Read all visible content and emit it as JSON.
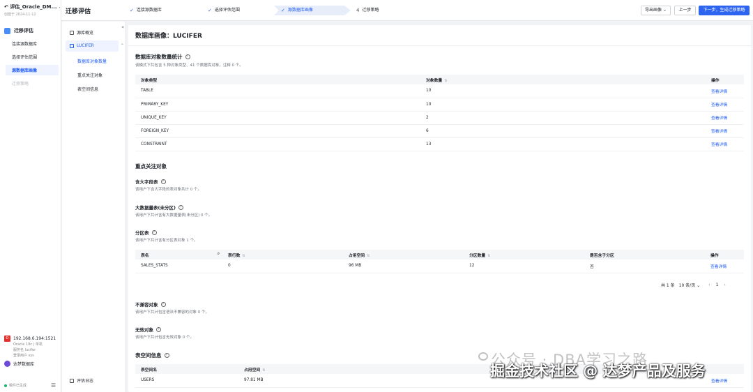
{
  "project": {
    "title": "评估_Oracle_DM...",
    "created": "创建于 2024-11-12"
  },
  "left_nav": {
    "section": "迁移评估",
    "items": [
      {
        "label": "连接源数据库",
        "state": "normal"
      },
      {
        "label": "选择评估范围",
        "state": "normal"
      },
      {
        "label": "源数据库画像",
        "state": "active"
      },
      {
        "label": "迁移策略",
        "state": "disabled"
      }
    ]
  },
  "source": {
    "ip": "192.168.6.194:1521",
    "desc1": "Oracle 19c | 单机",
    "desc2": "服务名 lucifer",
    "desc3": "登录用户 sys",
    "target": "达梦数据库"
  },
  "saved": "稿件已生成",
  "header": {
    "title": "迁移评估",
    "steps": [
      {
        "label": "连接源数据库",
        "state": "done"
      },
      {
        "label": "选择评估范围",
        "state": "done"
      },
      {
        "label": "源数据库画像",
        "state": "current"
      },
      {
        "label": "迁移策略",
        "num": "4",
        "state": "todo"
      }
    ],
    "export": "导出画像",
    "prev": "上一步",
    "next": "下一步，生成迁移策略"
  },
  "subnav": {
    "overview": "源库概览",
    "db": "LUCIFER",
    "subs": [
      "数据库对象数量",
      "重点关注对象",
      "表空间信息"
    ],
    "log": "评估日志"
  },
  "main": {
    "title": "数据库画像：LUCIFER",
    "obj_stats": {
      "title": "数据库对象数量统计",
      "desc": "该模式下共包含 5 种对象类型、41 个数据库对象，注释 0 个。",
      "columns": [
        "对象类型",
        "对象数量",
        "操作"
      ],
      "rows": [
        {
          "type": "TABLE",
          "count": "10",
          "action": "查看详情"
        },
        {
          "type": "PRIMARY_KEY",
          "count": "10",
          "action": "查看详情"
        },
        {
          "type": "UNIQUE_KEY",
          "count": "2",
          "action": "查看详情"
        },
        {
          "type": "FOREIGN_KEY",
          "count": "6",
          "action": "查看详情"
        },
        {
          "type": "CONSTRAINT",
          "count": "13",
          "action": "查看详情"
        }
      ]
    },
    "focus": {
      "title": "重点关注对象",
      "big_field": {
        "title": "含大字段表",
        "desc": "该用户下含大字段的表对象共计 0 个。"
      },
      "big_table": {
        "title": "大数据量表(未分区)",
        "desc": "该用户下共计含有大数据量表(未分区) 0 个。"
      },
      "partition": {
        "title": "分区表",
        "desc": "该用户下共计含有分区表对象 1 个。",
        "columns": [
          "表名",
          "表行数",
          "占用空间",
          "分区数量",
          "是否含子分区",
          "操作"
        ],
        "rows": [
          {
            "name": "SALES_STATS",
            "rows": "0",
            "space": "96 MB",
            "parts": "12",
            "sub": "否",
            "action": "查看详情"
          }
        ],
        "pager": {
          "total": "共 1 条",
          "size": "10 条/页",
          "page": "1"
        }
      },
      "incompat": {
        "title": "不兼容对象",
        "desc": "该用户下共计包含语法不兼容的对象 0 个。"
      },
      "invalid": {
        "title": "无效对象",
        "desc": "该用户下共计包含无效对象 0 个。"
      }
    },
    "tablespace": {
      "title": "表空间信息",
      "columns": [
        "表空间名",
        "占用空间"
      ],
      "rows": [
        {
          "name": "USERS",
          "space": "97.81 MB",
          "action": "查看详情"
        }
      ]
    }
  },
  "watermark": {
    "line1": "公众号 · DBA学习之路",
    "line2": "掘金技术社区 @ 达梦产品及服务"
  }
}
